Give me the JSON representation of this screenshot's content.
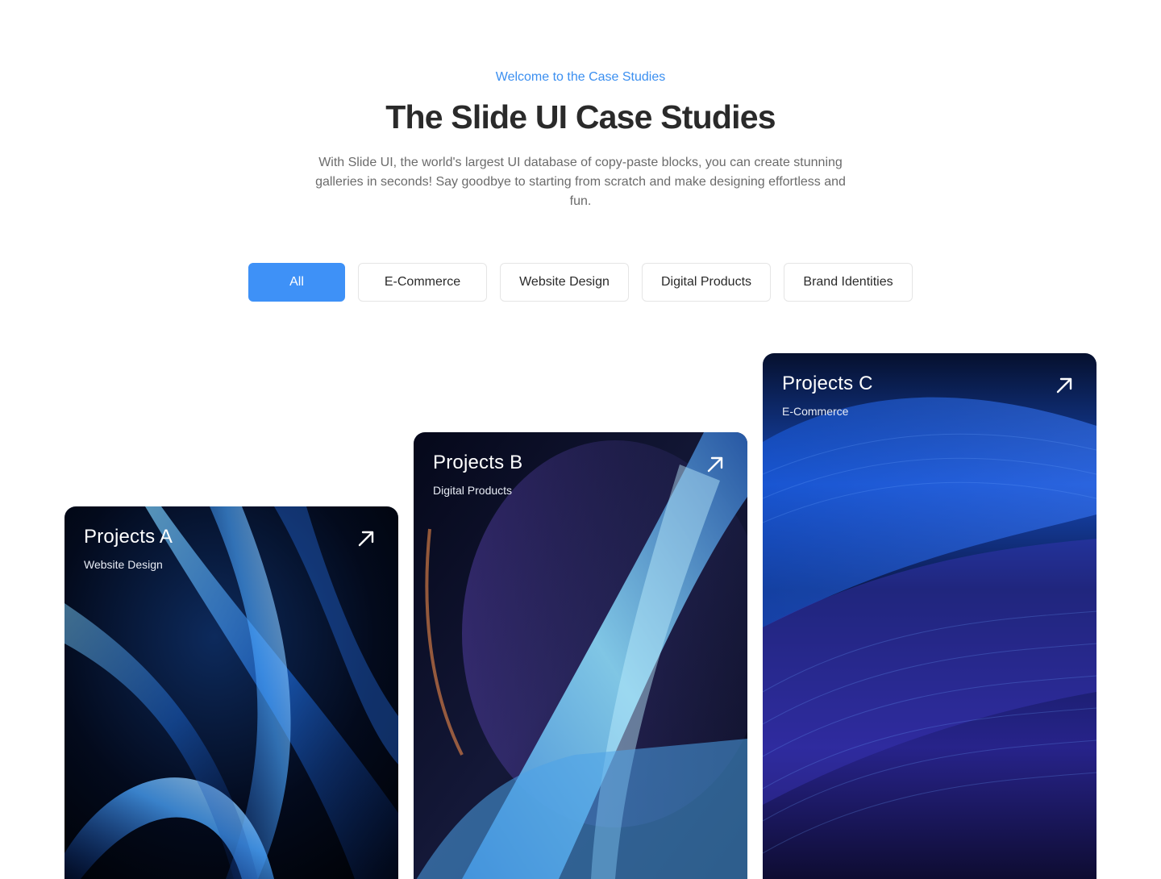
{
  "header": {
    "eyebrow": "Welcome to the Case Studies",
    "title": "The Slide UI Case Studies",
    "description": "With Slide UI, the world's largest UI database of copy-paste blocks, you can create stunning galleries in seconds! Say goodbye to starting from scratch and make designing effortless and fun."
  },
  "filters": [
    {
      "label": "All",
      "active": true
    },
    {
      "label": "E-Commerce",
      "active": false
    },
    {
      "label": "Website Design",
      "active": false
    },
    {
      "label": "Digital Products",
      "active": false
    },
    {
      "label": "Brand Identities",
      "active": false
    }
  ],
  "cards": [
    {
      "title": "Projects A",
      "category": "Website Design",
      "icon": "arrow-up-right-icon"
    },
    {
      "title": "Projects B",
      "category": "Digital Products",
      "icon": "arrow-up-right-icon"
    },
    {
      "title": "Projects C",
      "category": "E-Commerce",
      "icon": "arrow-up-right-icon"
    }
  ],
  "colors": {
    "accent": "#3e91f7",
    "eyebrow": "#3b8ff0",
    "heading": "#2a2a2a",
    "body_text": "#6b6b6b"
  }
}
